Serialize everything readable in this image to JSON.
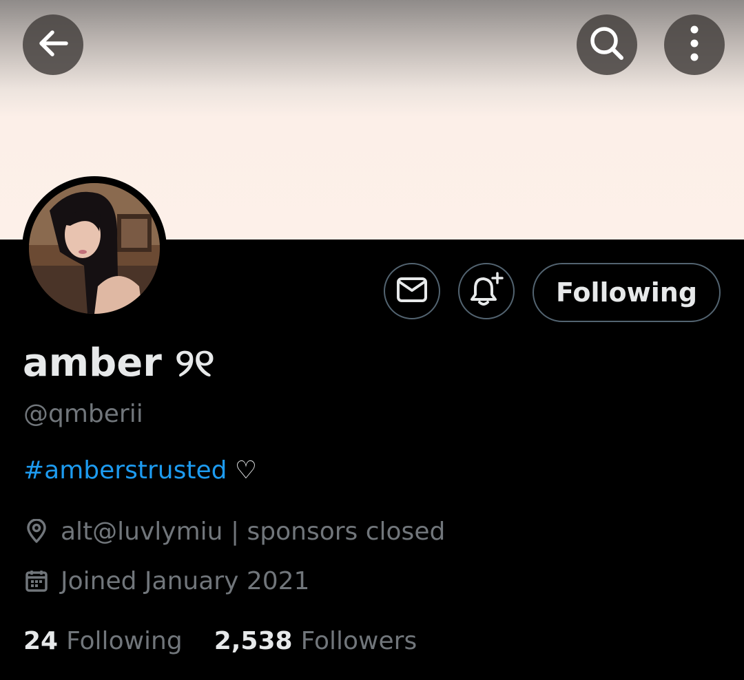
{
  "header": {
    "back_icon": "arrow-left-icon",
    "search_icon": "search-icon",
    "more_icon": "more-vertical-icon"
  },
  "profile": {
    "display_name": "amber ୨୧",
    "handle": "@qmberii",
    "bio": {
      "hashtag": "#amberstrusted",
      "suffix": " ♡"
    },
    "location": "alt@luvlymiu | sponsors closed",
    "joined": "Joined January 2021"
  },
  "actions": {
    "message_icon": "envelope-icon",
    "notify_icon": "bell-plus-icon",
    "following_label": "Following"
  },
  "stats": {
    "following_count": "24",
    "following_label": "Following",
    "followers_count": "2,538",
    "followers_label": "Followers"
  },
  "colors": {
    "background": "#000000",
    "text_primary": "#e7e9ea",
    "text_secondary": "#71767b",
    "link": "#1d9bf0",
    "border": "#536471",
    "banner": "#fdf0e9"
  }
}
